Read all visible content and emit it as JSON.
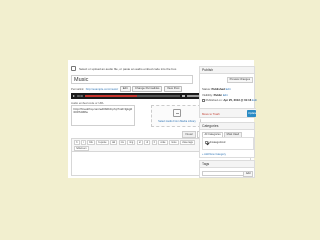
{
  "notice": {
    "text": "Select or upload an audio file, or paste an audio embed code into the box."
  },
  "post": {
    "title": "Music"
  },
  "permalink": {
    "label": "Permalink:",
    "url": "http://example.com/music/",
    "edit_label": "Edit",
    "change_label": "Change Permalinks",
    "view_label": "View Post"
  },
  "player": {
    "elapsed": "00:00",
    "progress": 0.55
  },
  "embed": {
    "label": "Audio embed code or URL",
    "value": "http://ft.tedchq.com/ed0b0b0.php?nid=fgkg00007d30fa"
  },
  "upload": {
    "link": "Select Audio From Media Library"
  },
  "editor_tabs": {
    "visual": "Visual",
    "text": "Text"
  },
  "toolbar": {
    "row1": [
      "b",
      "i",
      "link",
      "b-quote",
      "del",
      "ins",
      "img",
      "ul",
      "ol",
      "li",
      "code",
      "more",
      "close tags"
    ],
    "row2": [
      "fullscreen"
    ]
  },
  "publish": {
    "title": "Publish",
    "preview": "Preview Changes",
    "status_label": "Status:",
    "status_value": "Published",
    "visibility_label": "Visibility:",
    "visibility_value": "Public",
    "published_label": "Published on:",
    "published_value": "Apr 25, 2013 @ 01:16",
    "edit": "Edit",
    "trash": "Move to Trash",
    "update": "Update"
  },
  "categories": {
    "title": "Categories",
    "tab_all": "All Categories",
    "tab_used": "Most Used",
    "item": "Uncategorized",
    "add": "+ Add New Category"
  },
  "tags": {
    "title": "Tags",
    "add": "Add"
  }
}
